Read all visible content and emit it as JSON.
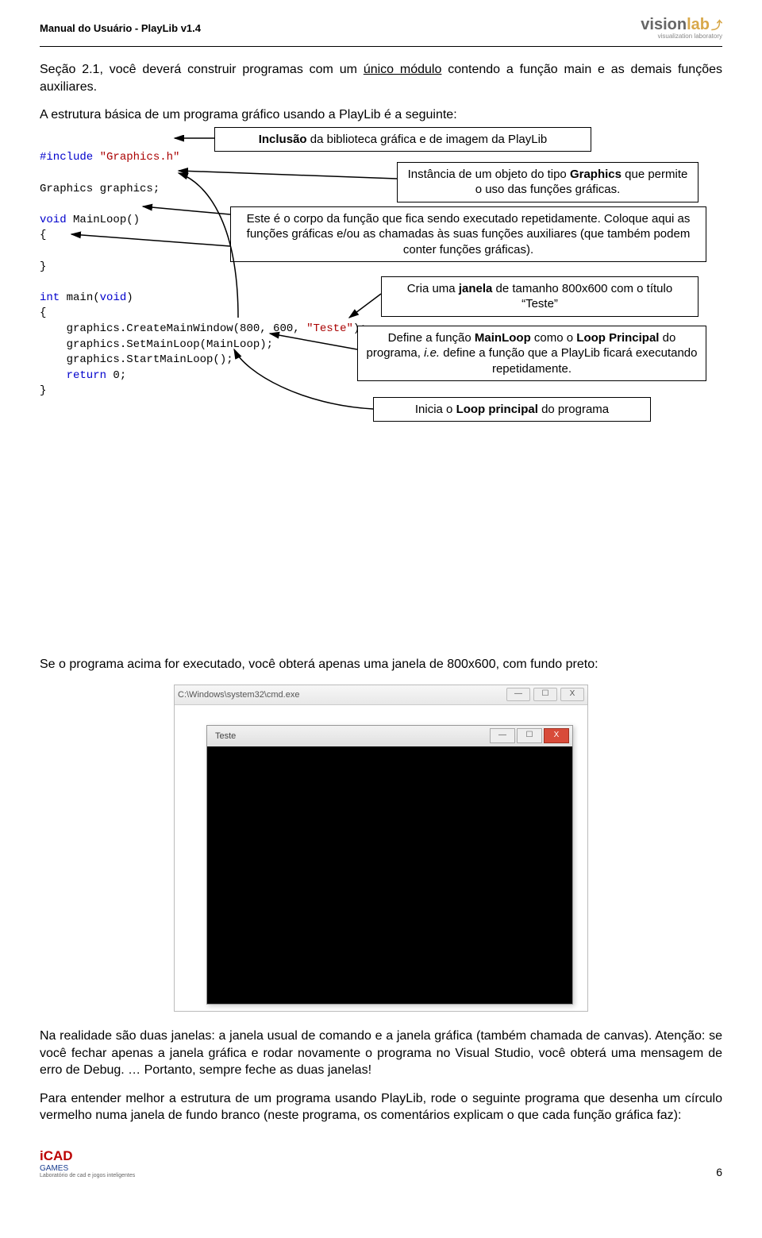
{
  "header": {
    "doc_title": "Manual do Usuário - PlayLib v1.4",
    "logo_vision": "vision",
    "logo_lab": "lab",
    "logo_sub": "visualization laboratory"
  },
  "paragraphs": {
    "p1_a": "Seção 2.1, você deverá construir programas com um ",
    "p1_u": "único módulo",
    "p1_b": " contendo a função main e as demais funções auxiliares.",
    "p2": "A estrutura básica de um programa gráfico usando a PlayLib é a seguinte:",
    "p3": "Se o programa acima for executado, você obterá apenas uma janela de 800x600, com fundo preto:",
    "p4": "Na realidade são duas janelas: a janela usual de comando e a janela gráfica (também chamada de canvas). Atenção: se você fechar apenas a janela gráfica e rodar novamente o programa no Visual Studio, você obterá uma mensagem de erro de Debug. … Portanto, sempre feche as duas janelas!",
    "p5": "Para entender melhor a estrutura de um programa usando PlayLib, rode o seguinte programa que desenha um círculo vermelho numa janela de fundo branco (neste programa, os comentários explicam o que cada função gráfica faz):"
  },
  "code": {
    "l1a": "#include",
    "l1b": "\"Graphics.h\"",
    "l2": "Graphics graphics;",
    "l3a": "void",
    "l3b": " MainLoop()",
    "l4": "{",
    "l5": "}",
    "l6a": "int",
    "l6b": " main(",
    "l6c": "void",
    "l6d": ")",
    "l7": "{",
    "l8a": "    graphics.CreateMainWindow(800, 600, ",
    "l8b": "\"Teste\"",
    "l8c": ");",
    "l9": "    graphics.SetMainLoop(MainLoop);",
    "l10": "    graphics.StartMainLoop();",
    "l11a": "    return",
    "l11b": " 0;",
    "l12": "}"
  },
  "callouts": {
    "c1_a": "Inclusão",
    "c1_b": " da biblioteca gráfica e de imagem da PlayLib",
    "c2_a": "Instância de um objeto do tipo ",
    "c2_b": "Graphics",
    "c2_c": " que permite o uso das funções gráficas.",
    "c3_a": "Este é o corpo da função que fica sendo executado repetidamente. Coloque aqui as funções gráficas e/ou as chamadas às suas funções auxiliares (que também podem conter funções gráficas).",
    "c4_a": "Cria uma ",
    "c4_b": "janela",
    "c4_c": " de tamanho 800x600 com o título “Teste”",
    "c5_a": "Define a função ",
    "c5_b": "MainLoop",
    "c5_c": " como o ",
    "c5_d": "Loop Principal",
    "c5_e": " do programa, ",
    "c5_f": "i.e.",
    "c5_g": " define a função que a PlayLib ficará executando repetidamente.",
    "c6_a": "Inicia o ",
    "c6_b": "Loop principal",
    "c6_c": " do programa"
  },
  "windows": {
    "cmd_title": "C:\\Windows\\system32\\cmd.exe",
    "teste_title": "Teste",
    "min": "—",
    "max": "☐",
    "close": "X"
  },
  "footer": {
    "icad": "iCAD",
    "games": "GAMES",
    "sub": "Laboratório de cad e jogos inteligentes",
    "page": "6"
  }
}
